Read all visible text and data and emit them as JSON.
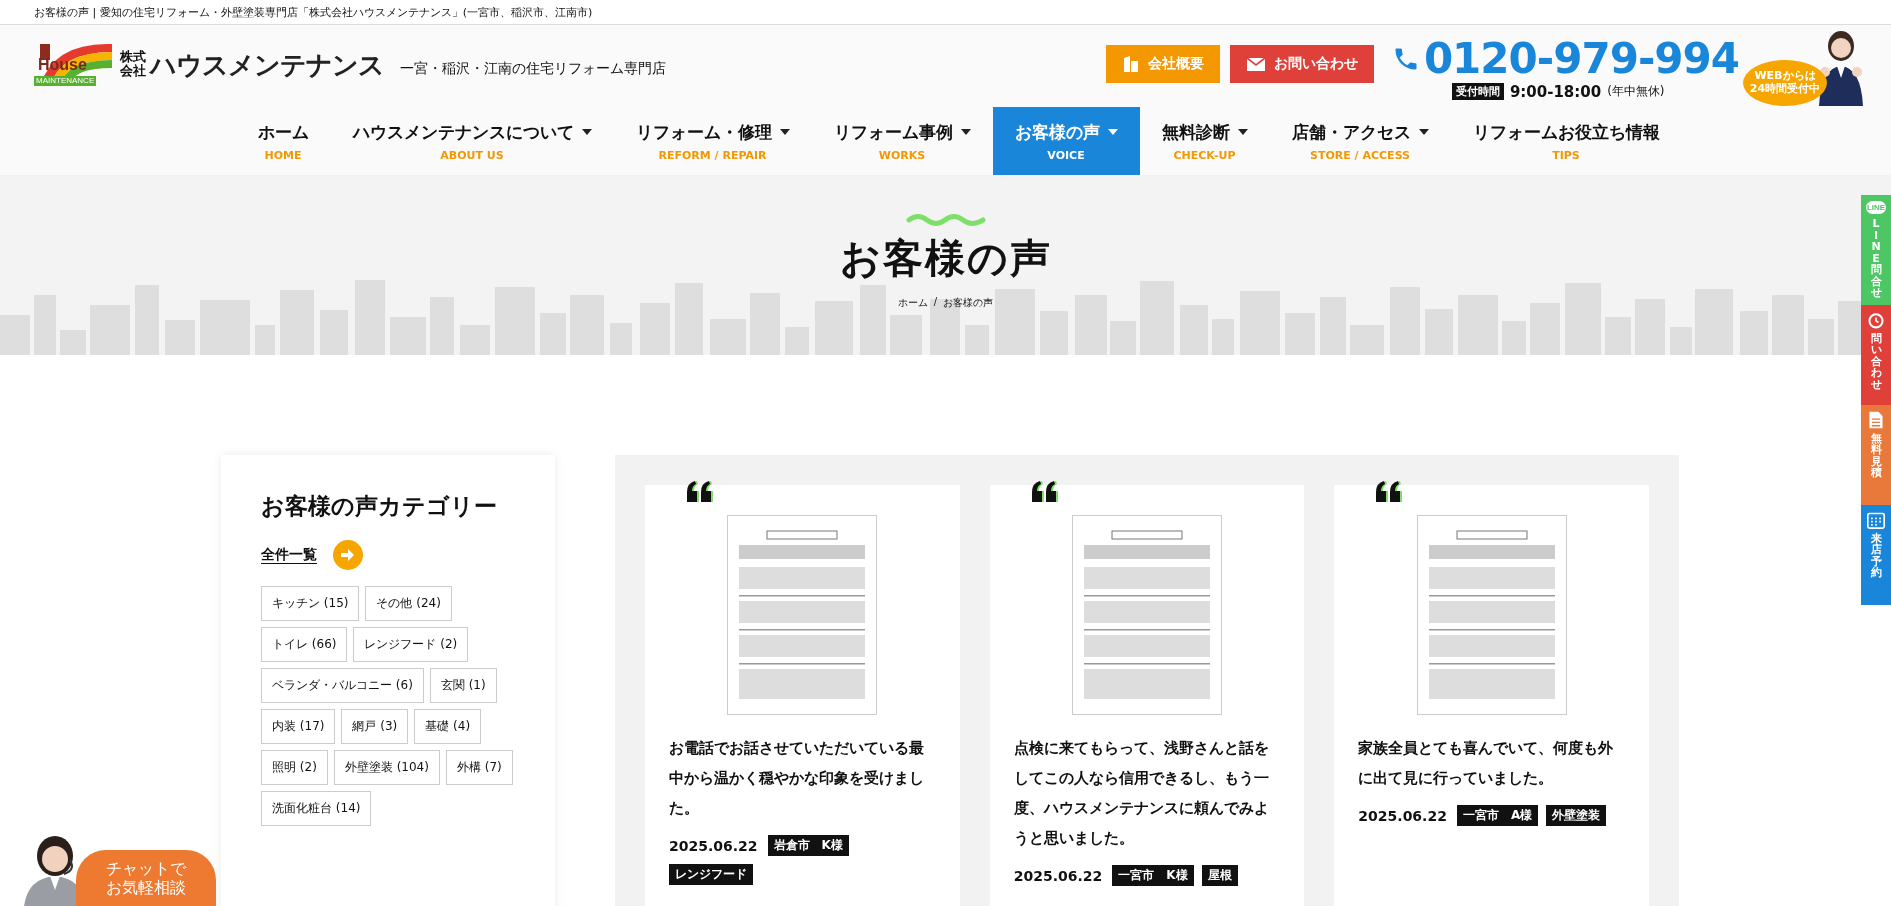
{
  "page_title": "お客様の声 | 愛知の住宅リフォーム・外壁塗装専門店「株式会社ハウスメンテナンス」(一宮市、稲沢市、江南市)",
  "header": {
    "logo": {
      "mark": "House",
      "mark_sub": "MAINTENANCE",
      "corp": "株式会社",
      "name": "ハウスメンテナンス"
    },
    "tagline": "一宮・稲沢・江南の住宅リフォーム専門店",
    "buttons": [
      {
        "label": "会社概要",
        "kind": "company"
      },
      {
        "label": "お問い合わせ",
        "kind": "contact"
      }
    ],
    "phone": {
      "number": "0120-979-994",
      "hours_label": "受付時間",
      "hours": "9:00-18:00",
      "note": "(年中無休)"
    },
    "web_badge": [
      "WEBからは",
      "24時間受付中"
    ]
  },
  "nav": [
    {
      "label": "ホーム",
      "sub": "HOME",
      "dropdown": false,
      "selected": false
    },
    {
      "label": "ハウスメンテナンスについて",
      "sub": "ABOUT US",
      "dropdown": true,
      "selected": false
    },
    {
      "label": "リフォーム・修理",
      "sub": "REFORM / REPAIR",
      "dropdown": true,
      "selected": false
    },
    {
      "label": "リフォーム事例",
      "sub": "WORKS",
      "dropdown": true,
      "selected": false
    },
    {
      "label": "お客様の声",
      "sub": "VOICE",
      "dropdown": true,
      "selected": true
    },
    {
      "label": "無料診断",
      "sub": "CHECK-UP",
      "dropdown": true,
      "selected": false
    },
    {
      "label": "店舗・アクセス",
      "sub": "STORE / ACCESS",
      "dropdown": true,
      "selected": false
    },
    {
      "label": "リフォームお役立ち情報",
      "sub": "TIPS",
      "dropdown": false,
      "selected": false
    }
  ],
  "hero": {
    "title": "お客様の声",
    "breadcrumb": [
      "ホーム",
      "お客様の声"
    ],
    "separator": "/"
  },
  "sidebar": {
    "title": "お客様の声カテゴリー",
    "all_link": "全件一覧",
    "categories": [
      "キッチン (15)",
      "その他 (24)",
      "トイレ (66)",
      "レンジフード (2)",
      "ベランダ・バルコニー (6)",
      "玄関 (1)",
      "内装 (17)",
      "網戸 (3)",
      "基礎 (4)",
      "照明 (2)",
      "外壁塗装 (104)",
      "外構 (7)",
      "洗面化粧台 (14)"
    ]
  },
  "cards": [
    {
      "text": "お電話でお話させていただいている最中から温かく穏やかな印象を受けました。",
      "date": "2025.06.22",
      "tags": [
        "岩倉市　K様",
        "レンジフード"
      ]
    },
    {
      "text": "点検に来てもらって、浅野さんと話をしてこの人なら信用できるし、もう一度、ハウスメンテナンスに頼んでみようと思いました。",
      "date": "2025.06.22",
      "tags": [
        "一宮市　K様",
        "屋根"
      ]
    },
    {
      "text": "家族全員とても喜んでいて、何度も外に出て見に行っていました。",
      "date": "2025.06.22",
      "tags": [
        "一宮市　A様",
        "外壁塗装"
      ]
    }
  ],
  "side_tabs": [
    {
      "label": "LINE問合せ",
      "kind": "line",
      "icon_text": "LINE"
    },
    {
      "label": "問い合わせ",
      "kind": "contact"
    },
    {
      "label": "無料見積",
      "kind": "estimate"
    },
    {
      "label": "来店予約",
      "kind": "visit"
    }
  ],
  "chat": {
    "lines": [
      "チャットで",
      "お気軽相談"
    ]
  }
}
